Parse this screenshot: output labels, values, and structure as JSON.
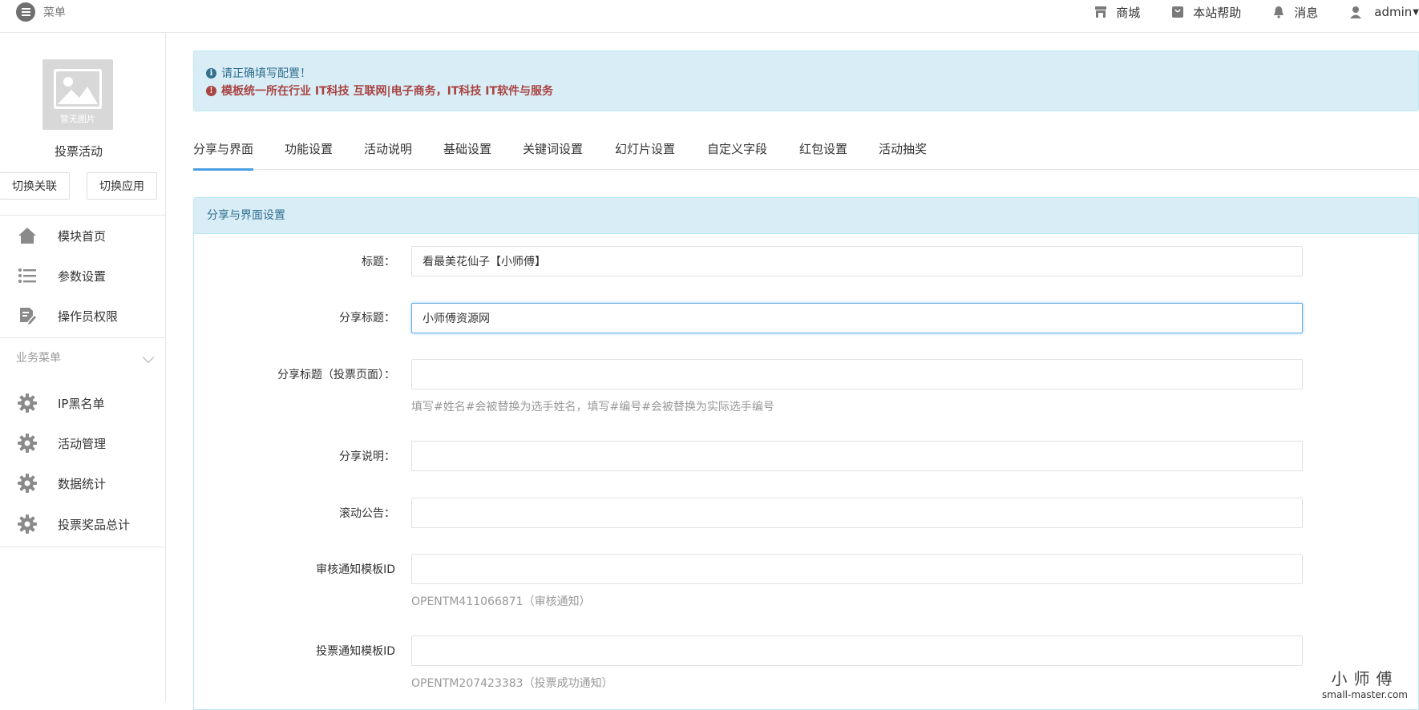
{
  "topbar": {
    "menu_label": "菜单",
    "items": [
      {
        "label": "商城",
        "icon": "store-icon"
      },
      {
        "label": "本站帮助",
        "icon": "help-bag-icon"
      },
      {
        "label": "消息",
        "icon": "bell-icon"
      },
      {
        "label": "admin",
        "icon": "user-icon"
      }
    ]
  },
  "sidebar": {
    "avatar_caption": "暂无图片",
    "app_name": "投票活动",
    "switch_link_label": "切换关联",
    "switch_app_label": "切换应用",
    "nav": [
      {
        "label": "模块首页",
        "icon": "home-icon"
      },
      {
        "label": "参数设置",
        "icon": "list-icon"
      },
      {
        "label": "操作员权限",
        "icon": "edit-document-icon"
      }
    ],
    "group_label": "业务菜单",
    "business": [
      {
        "label": "IP黑名单",
        "icon": "gear-icon"
      },
      {
        "label": "活动管理",
        "icon": "gear-icon"
      },
      {
        "label": "数据统计",
        "icon": "gear-icon"
      },
      {
        "label": "投票奖品总计",
        "icon": "gear-icon"
      }
    ]
  },
  "alert": {
    "info": "请正确填写配置！",
    "warning": "模板统一所在行业 IT科技 互联网|电子商务，IT科技 IT软件与服务"
  },
  "tabs": [
    "分享与界面",
    "功能设置",
    "活动说明",
    "基础设置",
    "关键词设置",
    "幻灯片设置",
    "自定义字段",
    "红包设置",
    "活动抽奖"
  ],
  "panel": {
    "title": "分享与界面设置",
    "fields": [
      {
        "label": "标题：",
        "value": "看最美花仙子【小师傅】"
      },
      {
        "label": "分享标题：",
        "value": "小师傅资源网"
      },
      {
        "label": "分享标题（投票页面）：",
        "value": "",
        "help": "填写#姓名#会被替换为选手姓名，填写#编号#会被替换为实际选手编号"
      },
      {
        "label": "分享说明：",
        "value": ""
      },
      {
        "label": "滚动公告：",
        "value": ""
      },
      {
        "label": "审核通知模板ID",
        "value": "",
        "help": "OPENTM411066871（审核通知）"
      },
      {
        "label": "投票通知模板ID",
        "value": "",
        "help": "OPENTM207423383（投票成功通知）"
      }
    ]
  },
  "watermark": {
    "title": "小师傅",
    "url": "small-master.com"
  },
  "colors": {
    "accent": "#4a9fe0",
    "alert_bg": "#d9edf7",
    "info_text": "#31708f",
    "warn_text": "#a94442"
  }
}
